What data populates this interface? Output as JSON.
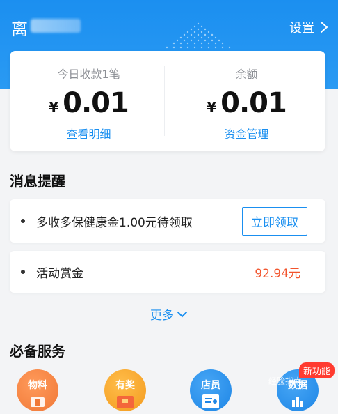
{
  "header": {
    "store_name_visible": "离",
    "settings_label": "设置",
    "colors": {
      "header_blue": "#1b8ff0"
    }
  },
  "summary": {
    "left": {
      "title": "今日收款1笔",
      "currency": "¥",
      "amount": "0.01",
      "link": "查看明细"
    },
    "right": {
      "title": "余额",
      "currency": "¥",
      "amount": "0.01",
      "link": "资金管理"
    }
  },
  "messages": {
    "title": "消息提醒",
    "items": [
      {
        "text": "多收多保健康金1.00元待领取",
        "action": "立即领取"
      },
      {
        "text": "活动赏金",
        "amount": "92.94元"
      }
    ],
    "more_label": "更多",
    "colors": {
      "accent": "#1a8ff0",
      "reward": "#f2542d"
    }
  },
  "services": {
    "title": "必备服务",
    "items": [
      {
        "label": "物料",
        "icon": "materials-icon",
        "color": "#f58a48"
      },
      {
        "label": "有奖",
        "icon": "prize-icon",
        "color": "#f7a531"
      },
      {
        "label": "店员",
        "icon": "staff-icon",
        "color": "#2e94ef"
      },
      {
        "label": "数据",
        "icon": "data-icon",
        "color": "#2e94ef",
        "badge": "新功能"
      }
    ]
  },
  "watermark": "经验指南"
}
